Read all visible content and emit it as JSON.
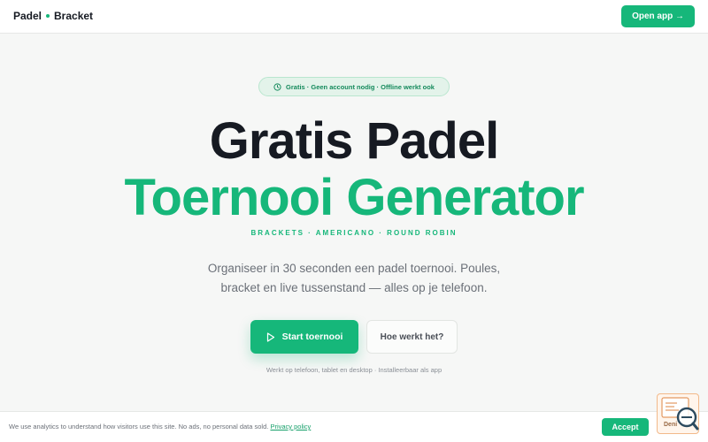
{
  "header": {
    "logo_left": "Padel",
    "logo_right": "Bracket",
    "open_app_label": "Open app →"
  },
  "hero": {
    "badge_text": "Gratis · Geen account nodig · Offline werkt ook",
    "title_line1": "Gratis Padel",
    "title_line2": "Toernooi Generator",
    "tags": "BRACKETS · AMERICANO · ROUND ROBIN",
    "description_line1": "Organiseer in 30 seconden een padel toernooi. Poules,",
    "description_line2": "bracket en live tussenstand — alles op je telefoon.",
    "start_label": "Start toernooi",
    "how_label": "Hoe werkt het?",
    "works_on": "Werkt op telefoon, tablet en desktop · Installeerbaar als app"
  },
  "cookie": {
    "text": "We use analytics to understand how visitors use this site. No ads, no personal data sold.",
    "link_label": "Privacy policy",
    "accept_label": "Accept"
  },
  "widget": {
    "label": "Deni",
    "icon": "search-document-icon"
  },
  "colors": {
    "accent": "#16b77a",
    "dark": "#161a22",
    "background": "#f6f7f6"
  }
}
